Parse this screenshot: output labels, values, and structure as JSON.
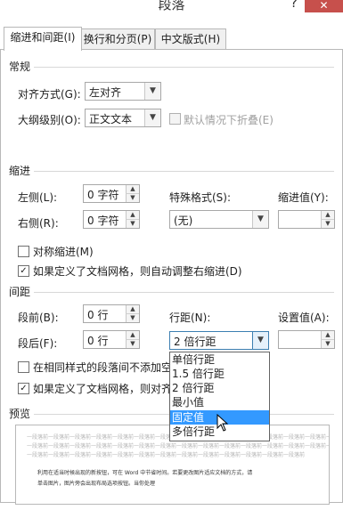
{
  "window": {
    "title": "段落",
    "help": "?",
    "close": "✕"
  },
  "tabs": [
    "缩进和间距(I)",
    "换行和分页(P)",
    "中文版式(H)"
  ],
  "general": {
    "section": "常规",
    "alignment_label": "对齐方式(G):",
    "alignment_value": "左对齐",
    "outline_label": "大纲级别(O):",
    "outline_value": "正文文本",
    "collapse_label": "默认情况下折叠(E)"
  },
  "indent": {
    "section": "缩进",
    "left_label": "左侧(L):",
    "left_value": "0 字符",
    "right_label": "右侧(R):",
    "right_value": "0 字符",
    "special_label": "特殊格式(S):",
    "special_value": "(无)",
    "by_label": "缩进值(Y):",
    "mirror_label": "对称缩进(M)",
    "mirror_checked": false,
    "auto_adjust_label": "如果定义了文档网格，则自动调整右缩进(D)",
    "auto_adjust_checked": true
  },
  "spacing": {
    "section": "间距",
    "before_label": "段前(B):",
    "before_value": "0 行",
    "after_label": "段后(F):",
    "after_value": "0 行",
    "line_label": "行距(N):",
    "line_value": "2 倍行距",
    "at_label": "设置值(A):",
    "no_space_label": "在相同样式的段落间不添加空格",
    "no_space_checked": false,
    "snap_label": "如果定义了文档网格，则对齐到",
    "snap_checked": true
  },
  "line_spacing_options": [
    "单倍行距",
    "1.5 倍行距",
    "2 倍行距",
    "最小值",
    "固定值",
    "多倍行距"
  ],
  "line_spacing_highlight": "固定值",
  "preview": {
    "section": "预览",
    "prev_line_1": "一段落前一段落前一段落前一段落前一段落前一段落前一段落前一段落前一段落前一段落前一段落前一段落前一段落前一段落前一段落前",
    "prev_line_2": "一段落前一段落前一段落前一段落前一段落前一段落前一段落前一段落前一段落前一段落前一段落前一段落前一段落前一段落前一段落前",
    "prev_line_3": "一段落前一段落前一段落前一段落前一段落前一段落前一段落前一段落前一段落前一段落前一段落前一段落前一段落前",
    "sample_1": "利用在适当时候出现的新按钮，可在 Word 中节省时间。若要更改图片适应文档的方式，请",
    "sample_2": "单击图片，图片旁会出现布局选项按钮。当你处理"
  }
}
